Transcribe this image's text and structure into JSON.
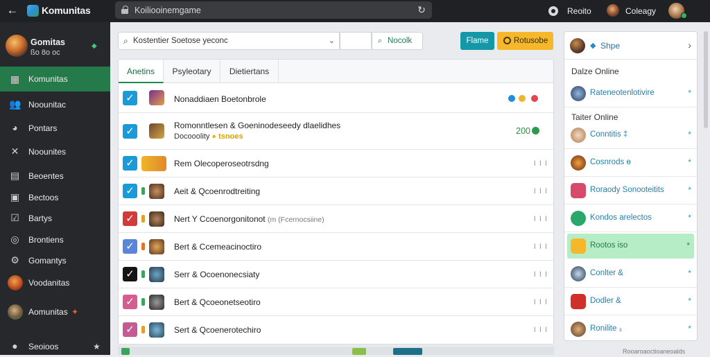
{
  "app": {
    "title": "Komunitas",
    "back_icon": "arrow-left-icon"
  },
  "search": {
    "value": "Koiliooinemgame",
    "icon": "lock-icon",
    "refresh_icon": "refresh-icon"
  },
  "topbar_right": {
    "record_label": "Reoito",
    "user_label": "Coleagy"
  },
  "sidebar": {
    "profile": {
      "name": "Gomitas",
      "sub": "ßo 8o oc"
    },
    "items": [
      {
        "label": "Komunitas",
        "icon": "grid-icon",
        "active": true
      },
      {
        "label": "Noounitac",
        "icon": "users-icon"
      },
      {
        "label": "Pontars",
        "icon": "compass-icon"
      },
      {
        "label": "Noounites",
        "icon": "tools-icon"
      },
      {
        "label": "Beoentes",
        "icon": "calendar-icon"
      },
      {
        "label": "Bectoos",
        "icon": "gallery-icon"
      },
      {
        "label": "Bartys",
        "icon": "check-icon"
      },
      {
        "label": "Brontiens",
        "icon": "target-icon"
      },
      {
        "label": "Gomantys",
        "icon": "settings-icon"
      },
      {
        "label": "Voodanitas",
        "icon": "avatar"
      },
      {
        "label": "Aomunitas",
        "icon": "avatar"
      }
    ],
    "footer": {
      "label": "Seoioos",
      "star": "★"
    }
  },
  "toolbar": {
    "filter_value": "Kostentier Soetose yeconc",
    "lookup_label": "Nocolk",
    "btn_primary": "Flame",
    "btn_secondary": "Rotusobe"
  },
  "tabs": [
    {
      "label": "Anetins",
      "active": true
    },
    {
      "label": "Psyleotary"
    },
    {
      "label": "Dietiertans"
    }
  ],
  "rows": [
    {
      "text": "Nonaddiaen  Boetonbrole",
      "check_color": "#1a9ad6",
      "meta": "dots"
    },
    {
      "text": "Romonntlesen & Goeninodeseedy dlaelidhes",
      "sub": "Docooolity",
      "tag": "tsnoes",
      "check_color": "#1a9ad6",
      "meta": "200"
    },
    {
      "text": "Rem Olecoperoseotrsdng",
      "check_color": "#1a9ad6",
      "meta": "bars"
    },
    {
      "text": "Aeit & Qcoenrodtreiting",
      "check_color": "#1a9ad6",
      "meta": "bars"
    },
    {
      "text": "Nert Y Ccoenorgonitonot",
      "text2": "(m (Fcernocsiine)",
      "check_color": "#d23b3b",
      "meta": "bars"
    },
    {
      "text": "Bert & Ccemeacinoctiro",
      "check_color": "#5b86d8",
      "meta": "bars"
    },
    {
      "text": "Serr & Ocoenonecsiaty",
      "check_color": "#141414",
      "meta": "bars"
    },
    {
      "text": "Bert & Qcoeonetseotiro",
      "check_color": "#d65e8f",
      "meta": "bars"
    },
    {
      "text": "Sert & Qcoenerotechiro",
      "check_color": "#c45c93",
      "meta": "bars"
    }
  ],
  "rows_meta": {
    "count_value": "200",
    "bars_glyph": "I I I"
  },
  "right_panel": {
    "header": "Shpe",
    "section1": "Dalze Online",
    "section2": "Taiter Online",
    "items": [
      {
        "label": "Rateneotenlotivire",
        "star": "*"
      },
      {
        "label": "Conntitis ‡",
        "star": "*"
      },
      {
        "label": "Cosnrods ɵ",
        "star": "*"
      },
      {
        "label": "Roraody Sonooteitits",
        "star": "*"
      },
      {
        "label": "Kondos arelectos",
        "star": "*"
      },
      {
        "label": "Rootos iso",
        "star": "*",
        "highlight": true
      },
      {
        "label": "Conlter &",
        "star": "*"
      },
      {
        "label": "Dodler &",
        "star": "*"
      },
      {
        "label": "Ronilite ₃",
        "star": "*"
      }
    ],
    "footer": "Rooaroaoctioaneoalds"
  },
  "colors": {
    "accent": "#257a4a",
    "teal": "#1497a6",
    "yellow": "#f6b82a",
    "sidebar_bg": "#26282c"
  }
}
